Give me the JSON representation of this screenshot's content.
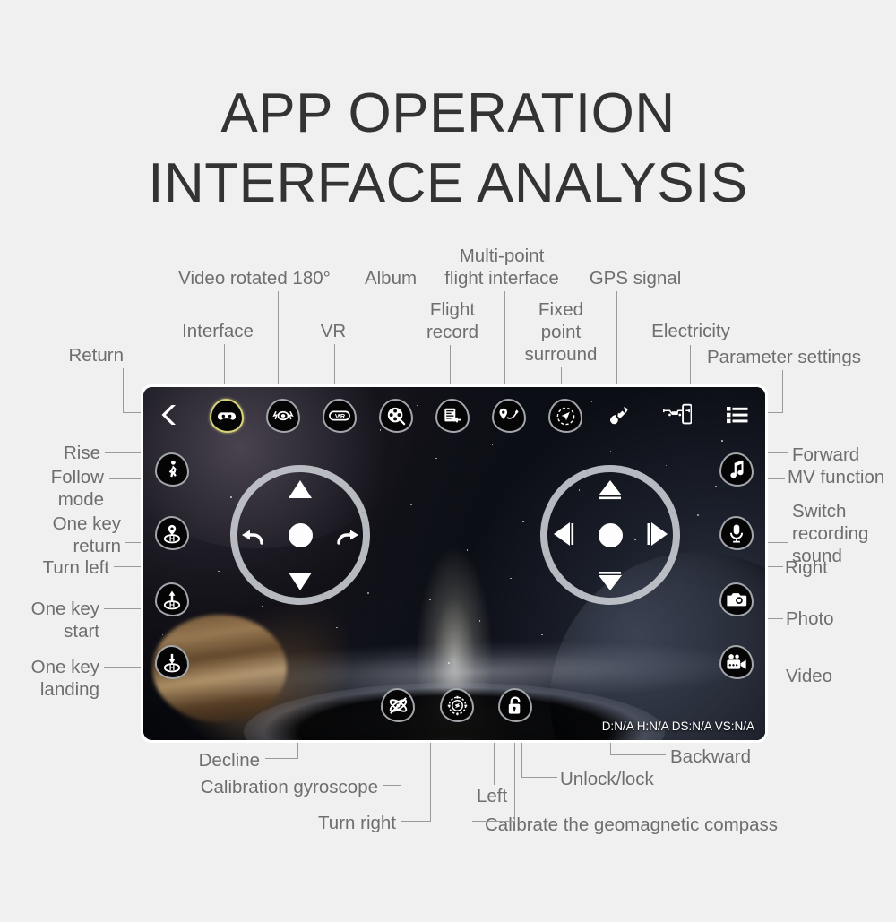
{
  "title": {
    "line1": "APP OPERATION",
    "line2": "INTERFACE ANALYSIS"
  },
  "colors": {
    "label_text": "#6e6e6e",
    "title_text": "#333333",
    "leader_line": "#9a9a9a",
    "page_background": "#f0f0f0",
    "button_border": "#a3a6ab",
    "active_button_border": "#d8d27a",
    "screen_border": "#ffffff"
  },
  "annotations": {
    "top": [
      {
        "id": "return",
        "label": "Return"
      },
      {
        "id": "interface",
        "label": "Interface"
      },
      {
        "id": "video-rotated-180",
        "label": "Video rotated 180°"
      },
      {
        "id": "vr",
        "label": "VR"
      },
      {
        "id": "album",
        "label": "Album"
      },
      {
        "id": "flight-record",
        "label": "Flight\nrecord"
      },
      {
        "id": "multi-point-flight-interface",
        "label": "Multi-point\nflight interface"
      },
      {
        "id": "fixed-point-surround",
        "label": "Fixed\npoint\nsurround"
      },
      {
        "id": "gps-signal",
        "label": "GPS signal"
      },
      {
        "id": "electricity",
        "label": "Electricity"
      },
      {
        "id": "parameter-settings",
        "label": "Parameter settings"
      }
    ],
    "left": [
      {
        "id": "rise",
        "label": "Rise"
      },
      {
        "id": "follow-mode",
        "label": "Follow\nmode"
      },
      {
        "id": "one-key-return",
        "label": "One key\nreturn"
      },
      {
        "id": "turn-left",
        "label": "Turn left"
      },
      {
        "id": "one-key-start",
        "label": "One key\nstart"
      },
      {
        "id": "one-key-landing",
        "label": "One key\nlanding"
      }
    ],
    "right": [
      {
        "id": "forward",
        "label": "Forward"
      },
      {
        "id": "mv-function",
        "label": "MV function"
      },
      {
        "id": "switch-recording-sound",
        "label": "Switch\nrecording\nsound"
      },
      {
        "id": "right",
        "label": "Right"
      },
      {
        "id": "photo",
        "label": "Photo"
      },
      {
        "id": "video",
        "label": "Video"
      }
    ],
    "bottom": [
      {
        "id": "decline",
        "label": "Decline"
      },
      {
        "id": "calibration-gyroscope",
        "label": "Calibration gyroscope"
      },
      {
        "id": "turn-right",
        "label": "Turn right"
      },
      {
        "id": "left",
        "label": "Left"
      },
      {
        "id": "unlock-lock",
        "label": "Unlock/lock"
      },
      {
        "id": "calibrate-the-geomagnetic-compass",
        "label": "Calibrate the geomagnetic compass"
      },
      {
        "id": "backward",
        "label": "Backward"
      }
    ]
  },
  "app": {
    "toolbar": [
      {
        "id": "return",
        "icon": "back-chevron-icon",
        "active": false,
        "shape": "plain"
      },
      {
        "id": "interface",
        "icon": "gamepad-icon",
        "active": true,
        "shape": "teardrop"
      },
      {
        "id": "video-rotated-180",
        "icon": "flip-video-icon",
        "active": false,
        "shape": "teardrop"
      },
      {
        "id": "vr",
        "icon": "vr-goggles-icon",
        "active": false,
        "shape": "teardrop"
      },
      {
        "id": "album",
        "icon": "film-reel-icon",
        "active": false,
        "shape": "teardrop"
      },
      {
        "id": "flight-record",
        "icon": "flight-record-icon",
        "active": false,
        "shape": "teardrop"
      },
      {
        "id": "multi-point-flight-interface",
        "icon": "waypoint-route-icon",
        "active": false,
        "shape": "teardrop"
      },
      {
        "id": "fixed-point-surround",
        "icon": "orbit-point-icon",
        "active": false,
        "shape": "teardrop"
      },
      {
        "id": "gps-signal",
        "icon": "satellite-icon",
        "active": false,
        "shape": "plain"
      },
      {
        "id": "electricity",
        "icon": "drone-battery-icon",
        "active": false,
        "shape": "plain"
      },
      {
        "id": "parameter-settings",
        "icon": "menu-lines-icon",
        "active": false,
        "shape": "plain"
      }
    ],
    "left_rail": [
      {
        "id": "follow-mode",
        "icon": "walking-person-icon"
      },
      {
        "id": "one-key-return",
        "icon": "pin-home-icon"
      },
      {
        "id": "one-key-start",
        "icon": "takeoff-home-icon"
      },
      {
        "id": "one-key-landing",
        "icon": "landing-home-icon"
      }
    ],
    "right_rail": [
      {
        "id": "mv-function",
        "icon": "music-note-icon"
      },
      {
        "id": "switch-recording-sound",
        "icon": "microphone-icon"
      },
      {
        "id": "photo",
        "icon": "camera-icon"
      },
      {
        "id": "video",
        "icon": "video-camera-icon"
      }
    ],
    "bottom_bar": [
      {
        "id": "calibration-gyroscope",
        "icon": "gyroscope-icon"
      },
      {
        "id": "calibrate-the-geomagnetic-compass",
        "icon": "compass-icon"
      },
      {
        "id": "unlock-lock",
        "icon": "unlock-padlock-icon"
      }
    ],
    "left_joystick": {
      "up": "rise-triangle-icon",
      "down": "decline-triangle-icon",
      "left": "rotate-left-icon",
      "right": "rotate-right-icon"
    },
    "right_joystick": {
      "up": "forward-triangle-icon",
      "down": "backward-triangle-icon",
      "left": "left-triangle-icon",
      "right": "right-triangle-icon"
    },
    "status_bar": "D:N/A H:N/A DS:N/A VS:N/A"
  }
}
